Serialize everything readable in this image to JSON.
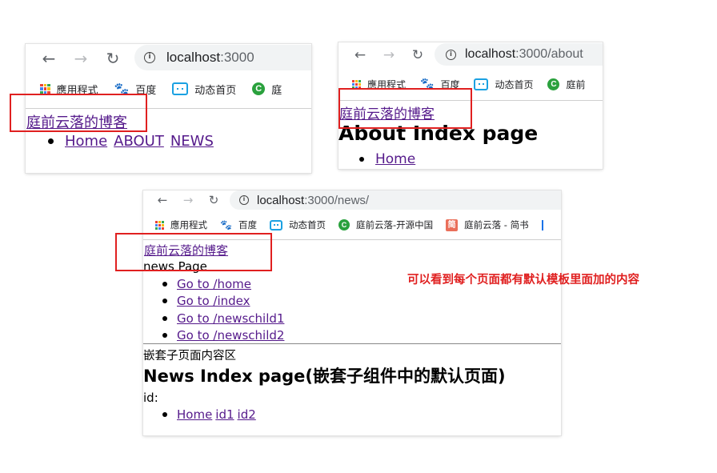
{
  "shot_home": {
    "url_host": "localhost",
    "url_path": ":3000",
    "bookmarks": [
      "應用程式",
      "百度",
      "动态首页",
      "庭"
    ],
    "site_title": "庭前云落的博客",
    "nav_links": [
      "Home",
      "ABOUT",
      "NEWS"
    ]
  },
  "shot_about": {
    "url_host": "localhost",
    "url_path": ":3000/about",
    "bookmarks": [
      "應用程式",
      "百度",
      "动态首页",
      "庭前"
    ],
    "site_title": "庭前云落的博客",
    "heading": "About Index page",
    "nav_links": [
      "Home"
    ]
  },
  "shot_news": {
    "url_host": "localhost",
    "url_path": ":3000/news/",
    "bookmarks": [
      "應用程式",
      "百度",
      "动态首页",
      "庭前云落-开源中国",
      "庭前云落 - 简书"
    ],
    "jian_glyph": "简",
    "site_title": "庭前云落的博客",
    "page_label": "news Page",
    "nav_links": [
      "Go to /home",
      "Go to /index",
      "Go to /newschild1",
      "Go to /newschild2"
    ],
    "nested_label": "嵌套子页面内容区",
    "heading": "News Index page(嵌套子组件中的默认页面)",
    "id_label": "id:",
    "id_links": [
      "Home",
      "id1",
      "id2"
    ]
  },
  "annotation": "可以看到每个页面都有默认模板里面加的内容",
  "colors": {
    "highlight_box": "#e02020",
    "visited_link": "#551a8b",
    "annotation": "#e02020"
  },
  "icons": [
    "back-arrow-icon",
    "forward-arrow-icon",
    "reload-icon",
    "info-icon",
    "apps-grid-icon",
    "baidu-paw-icon",
    "bilibili-tv-icon",
    "oschina-c-icon",
    "jianshu-icon"
  ]
}
